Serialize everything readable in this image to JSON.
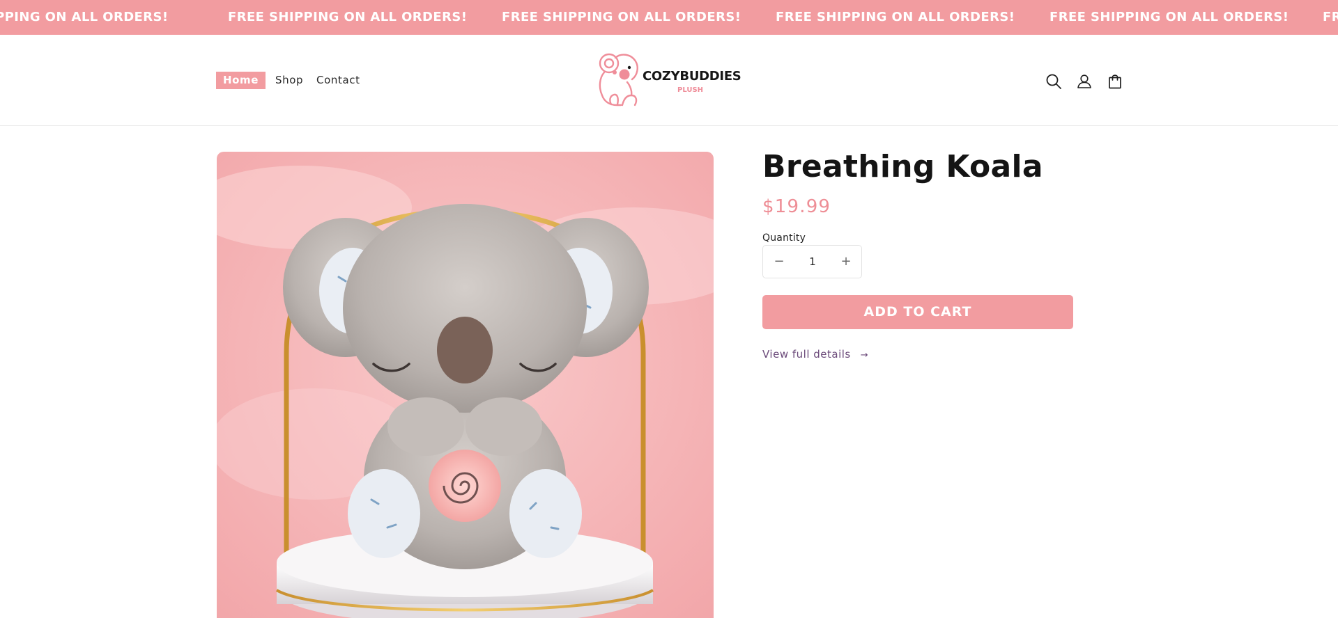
{
  "announcement": {
    "items": [
      "IPPING ON ALL ORDERS!",
      "FREE SHIPPING ON ALL ORDERS!",
      "FREE SHIPPING ON ALL ORDERS!",
      "FREE SHIPPING ON ALL ORDERS!",
      "FREE SHIPPING ON ALL ORDERS!",
      "FR"
    ]
  },
  "nav": {
    "home": "Home",
    "shop": "Shop",
    "contact": "Contact"
  },
  "logo": {
    "name": "COZYBUDDIES",
    "tagline": "PLUSH"
  },
  "product": {
    "title": "Breathing Koala",
    "price": "$19.99",
    "quantity_label": "Quantity",
    "quantity_value": "1",
    "decrease_label": "−",
    "increase_label": "+",
    "add_to_cart": "ADD TO CART",
    "view_details": "View full details",
    "view_details_arrow": "→"
  },
  "colors": {
    "accent": "#f29ca0",
    "price": "#ee8e96",
    "link": "#6b4a7a"
  },
  "icons": {
    "search": "search-icon",
    "account": "account-icon",
    "cart": "cart-icon"
  }
}
